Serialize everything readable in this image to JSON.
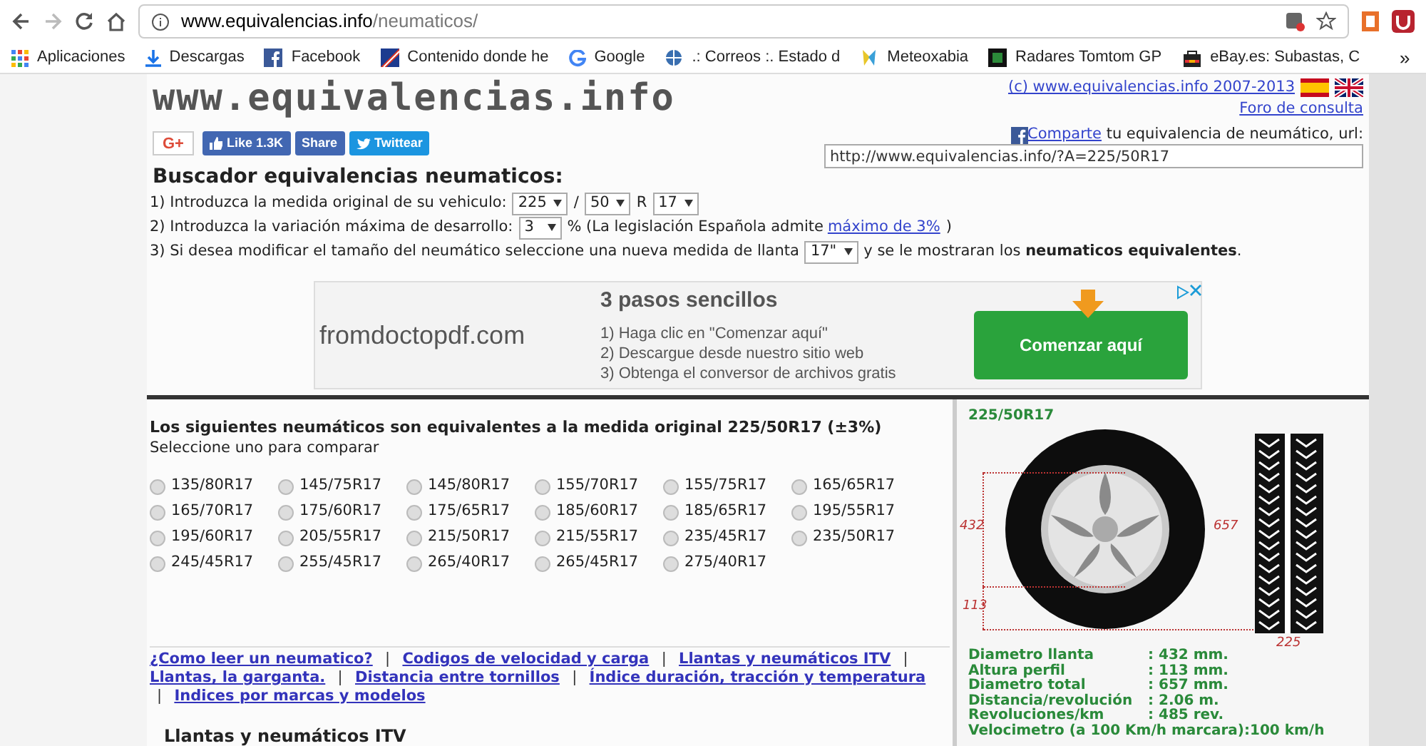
{
  "browser": {
    "url_host": "www.equivalencias.info",
    "url_path": "/neumaticos/",
    "bookmarks": [
      {
        "label": "Aplicaciones"
      },
      {
        "label": "Descargas"
      },
      {
        "label": "Facebook"
      },
      {
        "label": "Contenido donde he"
      },
      {
        "label": "Google"
      },
      {
        "label": ".: Correos :. Estado d"
      },
      {
        "label": "Meteoxabia"
      },
      {
        "label": "Radares Tomtom GP"
      },
      {
        "label": "eBay.es: Subastas, C"
      }
    ],
    "overflow": "»"
  },
  "header": {
    "logo": "www.equivalencias.info",
    "copyright": "(c) www.equivalencias.info 2007-2013",
    "forum": "Foro de consulta",
    "social": [
      {
        "kind": "gplus",
        "label": "G+"
      },
      {
        "kind": "like",
        "label": "Like 1.3K"
      },
      {
        "kind": "share",
        "label": "Share"
      },
      {
        "kind": "tweet",
        "label": "Twittear"
      }
    ],
    "share_link": "Comparte",
    "share_text": " tu equivalencia de neumático, url:",
    "share_url": "http://www.equivalencias.info/?A=225/50R17"
  },
  "title": "Buscador equivalencias neumaticos:",
  "steps": [
    [
      {
        "kind": "text",
        "text": "1) Introduzca la medida original de su vehiculo:"
      },
      {
        "kind": "select",
        "text": "225"
      },
      {
        "kind": "text",
        "text": "/"
      },
      {
        "kind": "select",
        "text": "50"
      },
      {
        "kind": "text",
        "text": "R"
      },
      {
        "kind": "select",
        "text": "17"
      }
    ],
    [
      {
        "kind": "text",
        "text": "2) Introduzca la variación máxima de desarrollo:"
      },
      {
        "kind": "select",
        "text": "3"
      },
      {
        "kind": "text",
        "text": "% (La legislación Española admite"
      },
      {
        "kind": "link",
        "text": "máximo de 3%"
      },
      {
        "kind": "text",
        "text": ")"
      }
    ],
    [
      {
        "kind": "text",
        "text": "3) Si desea modificar el tamaño del neumático seleccione una nueva medida de llanta"
      },
      {
        "kind": "select",
        "text": "17\""
      },
      {
        "kind": "text",
        "text": "y se le mostraran los **neumaticos equivalentes**."
      }
    ]
  ],
  "ad": {
    "domain": "fromdoctopdf.com",
    "headline": "3 pasos sencillos",
    "lines": [
      "1) Haga clic en \"Comenzar aquí\"",
      "2) Descargue desde nuestro sitio web",
      "3) Obtenga el conversor de archivos gratis"
    ],
    "button": "Comenzar aquí"
  },
  "equivalents": {
    "heading": "Los siguientes neumáticos son equivalentes a la medida original 225/50R17 (±3%)",
    "subheading": "Seleccione uno para comparar",
    "options": [
      {
        "label": "135/80R17",
        "selected": false
      },
      {
        "label": "145/75R17",
        "selected": false
      },
      {
        "label": "145/80R17",
        "selected": false
      },
      {
        "label": "155/70R17",
        "selected": false
      },
      {
        "label": "155/75R17",
        "selected": false
      },
      {
        "label": "165/65R17",
        "selected": false
      },
      {
        "label": "165/70R17",
        "selected": false
      },
      {
        "label": "175/60R17",
        "selected": false
      },
      {
        "label": "175/65R17",
        "selected": false
      },
      {
        "label": "185/60R17",
        "selected": false
      },
      {
        "label": "185/65R17",
        "selected": false
      },
      {
        "label": "195/55R17",
        "selected": false
      },
      {
        "label": "195/60R17",
        "selected": false
      },
      {
        "label": "205/55R17",
        "selected": false
      },
      {
        "label": "215/50R17",
        "selected": false
      },
      {
        "label": "215/55R17",
        "selected": false
      },
      {
        "label": "235/45R17",
        "selected": false
      },
      {
        "label": "235/50R17",
        "selected": false
      },
      {
        "label": "245/45R17",
        "selected": false
      },
      {
        "label": "255/45R17",
        "selected": false
      },
      {
        "label": "265/40R17",
        "selected": false
      },
      {
        "label": "265/45R17",
        "selected": false
      },
      {
        "label": "275/40R17",
        "selected": false
      }
    ]
  },
  "links": [
    {
      "kind": "link",
      "text": "¿Como leer un neumatico?"
    },
    {
      "kind": "separator",
      "text": "|"
    },
    {
      "kind": "link",
      "text": "Codigos de velocidad y carga"
    },
    {
      "kind": "separator",
      "text": "|"
    },
    {
      "kind": "link",
      "text": "Llantas y neumáticos ITV"
    },
    {
      "kind": "separator",
      "text": "|"
    },
    {
      "kind": "link",
      "text": "Llantas, la garganta."
    },
    {
      "kind": "separator",
      "text": "|"
    },
    {
      "kind": "link",
      "text": "Distancia entre tornillos"
    },
    {
      "kind": "separator",
      "text": "|"
    },
    {
      "kind": "link",
      "text": "Índice duración, tracción y temperatura"
    },
    {
      "kind": "separator",
      "text": "|"
    },
    {
      "kind": "link",
      "text": "Indices por marcas y modelos"
    }
  ],
  "section_heading": "Llantas y neumáticos ITV",
  "tire": {
    "size": "225/50R17",
    "rim_dim": "432",
    "total_dim": "657",
    "profile_dim": "113",
    "width_dim": "225",
    "specs": [
      {
        "label": "Diametro llanta",
        "value": ": 432 mm."
      },
      {
        "label": "Altura perfil",
        "value": ": 113 mm."
      },
      {
        "label": "Diametro total",
        "value": ": 657 mm."
      },
      {
        "label": "Distancia/revolución",
        "value": ": 2.06 m."
      },
      {
        "label": "Revoluciones/km",
        "value": ": 485 rev."
      },
      {
        "label": "Velocimetro (a 100 Km/h marcara)",
        "value": ":100 km/h"
      }
    ]
  }
}
